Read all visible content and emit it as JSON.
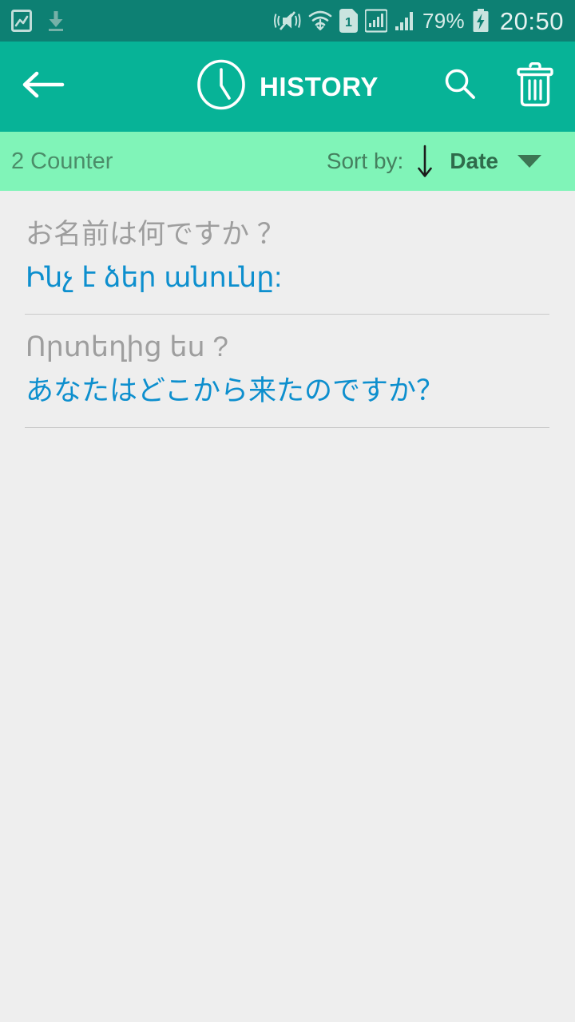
{
  "status_bar": {
    "background": "#0d8073",
    "left_icons": [
      "screenshot-icon",
      "download-icon"
    ],
    "right_icons": [
      "vibrate-mute-icon",
      "wifi-icon",
      "sim-1-icon",
      "signal-1-icon",
      "signal-2-icon"
    ],
    "battery_percent": "79%",
    "battery_state": "charging",
    "clock": "20:50"
  },
  "app_bar": {
    "background": "#07b397",
    "back_label": "back-arrow",
    "title": "HISTORY",
    "title_icon": "clock-icon",
    "search_label": "search-icon",
    "delete_label": "trash-icon"
  },
  "sort_bar": {
    "background": "#80f4b8",
    "counter": "2 Counter",
    "sort_by_label": "Sort by:",
    "sort_direction": "descending",
    "sort_value": "Date",
    "dropdown_label": "chevron-down-icon"
  },
  "list": {
    "items": [
      {
        "source_text": "お名前は何ですか ？",
        "target_text": "Ինչ է ձեր անունը:"
      },
      {
        "source_text": "Որտեղից ես ?",
        "target_text": "あなたはどこから来たのですか？"
      }
    ]
  },
  "colors": {
    "status_bar": "#0d8073",
    "app_bar": "#07b397",
    "sort_bar": "#80f4b8",
    "body": "#eeeeee",
    "source_text": "#9e9e9e",
    "target_text": "#0d8fce",
    "divider": "#c9c9c9"
  }
}
